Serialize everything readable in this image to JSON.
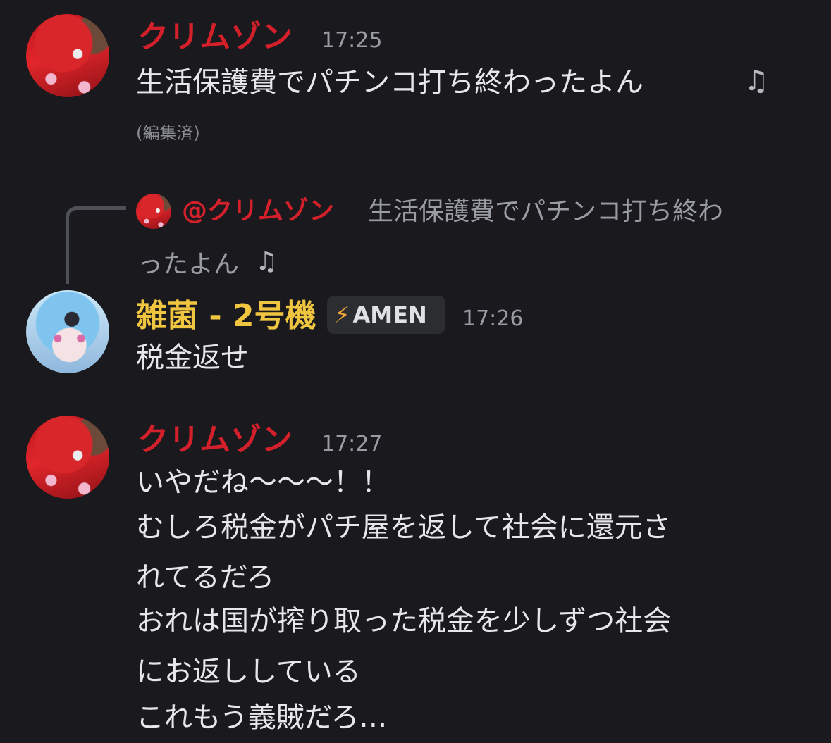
{
  "colors": {
    "crimson_name": "#d4202b",
    "zakin_name": "#f0c53f",
    "background": "#1a1a1e"
  },
  "messages": [
    {
      "author": "クリムゾン",
      "time": "17:25",
      "lines": [
        "生活保護費でパチンコ打ち終わったよん"
      ],
      "note_icon": "music-note-icon",
      "edited": "(編集済)"
    },
    {
      "reply": {
        "author": "@クリムゾン",
        "preview_line1": "生活保護費でパチンコ打ち終わ",
        "preview_line2": "ったよん"
      },
      "author": "雑菌 - 2号機",
      "badge": "AMEN",
      "badge_icon": "lightning-icon",
      "time": "17:26",
      "lines": [
        "税金返せ"
      ]
    },
    {
      "author": "クリムゾン",
      "time": "17:27",
      "lines": [
        "いやだね〜〜〜！！",
        "むしろ税金がパチ屋を返して社会に還元さ",
        "れてるだろ",
        "おれは国が搾り取った税金を少しずつ社会",
        "にお返ししている",
        "これもう義賊だろ…"
      ]
    }
  ]
}
